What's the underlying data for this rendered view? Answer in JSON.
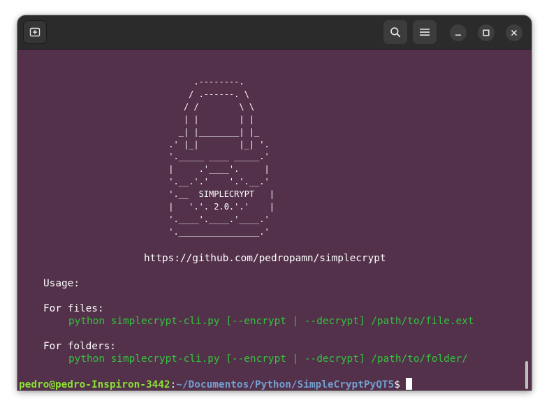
{
  "titlebar": {
    "new_tab_icon": "new-tab-icon",
    "search_icon": "search-icon",
    "menu_icon": "hamburger-menu-icon",
    "minimize_icon": "minimize-icon",
    "maximize_icon": "maximize-icon",
    "close_icon": "close-icon"
  },
  "terminal": {
    "banner": "      .--------.\n     / .------. \\\n    / /        \\ \\\n    | |        | |\n   _| |________| |_\n .' |_|        |_| '.\n '._____ ____ _____.'\n |     .'____'.     |\n '.__.'.'    '.'.__.'\n '.__  SIMPLECRYPT   |\n |   '.'. 2.0.'.'    |\n '.____'.____.'____.'\n '.________________.'",
    "url": "https://github.com/pedropamn/simplecrypt",
    "usage_label": "Usage:",
    "files_label": "For files:",
    "files_command": "python simplecrypt-cli.py [--encrypt | --decrypt] /path/to/file.ext",
    "folders_label": "For folders:",
    "folders_command": "python simplecrypt-cli.py [--encrypt | --decrypt] /path/to/folder/",
    "prompt_user": "pedro@pedro-Inspiron-3442",
    "prompt_sep": ":",
    "prompt_path": "~/Documentos/Python/SimpleCryptPyQT5",
    "prompt_symbol": "$"
  },
  "colors": {
    "terminal_bg": "#53314a",
    "titlebar_bg": "#2b2b2b",
    "command_green": "#33c33d",
    "prompt_user_green": "#8ae234",
    "prompt_path_blue": "#729fcf"
  }
}
